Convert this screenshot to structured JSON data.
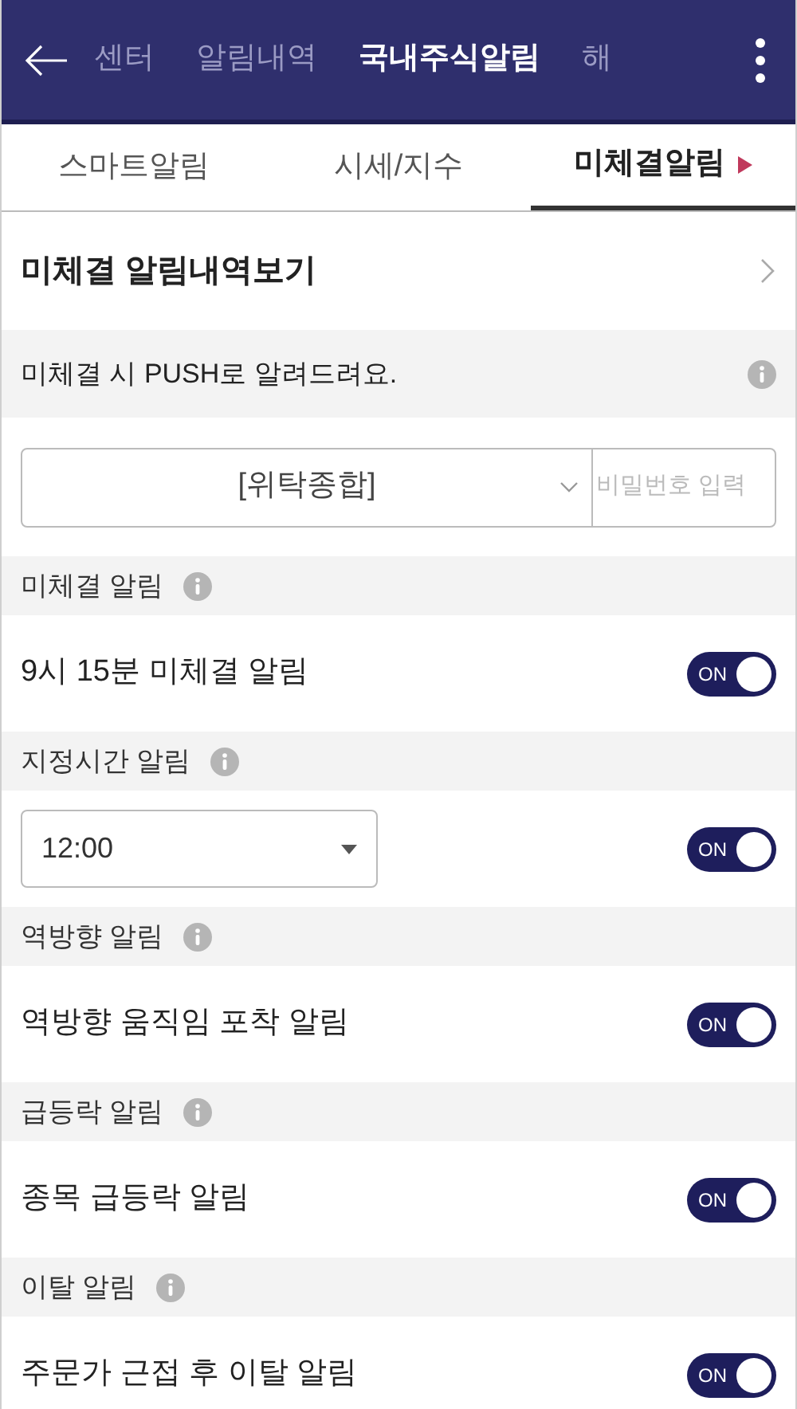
{
  "top_tabs": [
    {
      "label": "센터",
      "selected": false
    },
    {
      "label": "알림내역",
      "selected": false
    },
    {
      "label": "국내주식알림",
      "selected": true
    },
    {
      "label": "해",
      "selected": false
    }
  ],
  "sub_tabs": [
    {
      "label": "스마트알림",
      "selected": false
    },
    {
      "label": "시세/지수",
      "selected": false
    },
    {
      "label": "미체결알림",
      "selected": true
    }
  ],
  "history_link": "미체결 알림내역보기",
  "notice": "미체결 시 PUSH로 알려드려요.",
  "account_select": {
    "value": "[위탁종합]",
    "password_placeholder": "비밀번호 입력"
  },
  "sections": [
    {
      "title": "미체결 알림",
      "kind": "toggle",
      "label": "9시 15분 미체결 알림",
      "toggle": {
        "on": true,
        "text": "ON"
      }
    },
    {
      "title": "지정시간 알림",
      "kind": "time_select",
      "value": "12:00",
      "toggle": {
        "on": true,
        "text": "ON"
      }
    },
    {
      "title": "역방향 알림",
      "kind": "toggle",
      "label": "역방향 움직임 포착 알림",
      "toggle": {
        "on": true,
        "text": "ON"
      }
    },
    {
      "title": "급등락 알림",
      "kind": "toggle",
      "label": "종목 급등락 알림",
      "toggle": {
        "on": true,
        "text": "ON"
      }
    },
    {
      "title": "이탈 알림",
      "kind": "toggle",
      "label": "주문가 근접 후 이탈 알림",
      "toggle": {
        "on": true,
        "text": "ON"
      }
    }
  ]
}
